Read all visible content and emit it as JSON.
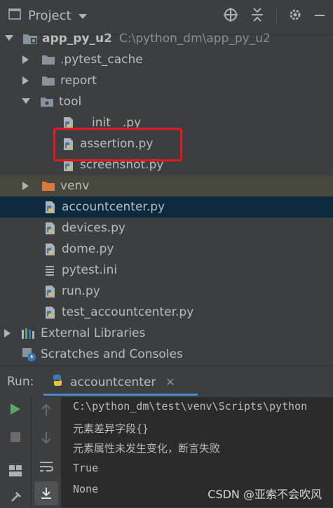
{
  "toolbar": {
    "title": "Project",
    "icons": [
      "target-icon",
      "collapse-icon",
      "gear-icon",
      "minimize-icon"
    ]
  },
  "tree": {
    "root": {
      "name": "app_py_u2",
      "path": "C:\\python_dm\\app_py_u2"
    },
    "items": [
      {
        "label": ".pytest_cache"
      },
      {
        "label": "report"
      },
      {
        "label": "tool"
      },
      {
        "label": "__init__.py"
      },
      {
        "label": "assertion.py"
      },
      {
        "label": "screenshot.py"
      },
      {
        "label": "venv"
      },
      {
        "label": "accountcenter.py"
      },
      {
        "label": "devices.py"
      },
      {
        "label": "dome.py"
      },
      {
        "label": "pytest.ini"
      },
      {
        "label": "run.py"
      },
      {
        "label": "test_accountcenter.py"
      },
      {
        "label": "External Libraries"
      },
      {
        "label": "Scratches and Consoles"
      }
    ]
  },
  "run": {
    "label": "Run:",
    "tab": "accountcenter"
  },
  "console": {
    "lines": [
      "C:\\python_dm\\test\\venv\\Scripts\\python",
      "元素差异字段{}",
      "元素属性未发生变化，断言失败",
      "True",
      "None"
    ]
  },
  "watermark": "CSDN @亚索不会吹风",
  "colors": {
    "background": "#3c3f41",
    "selected_row": "#0d293e",
    "highlight_box": "#e8161f",
    "run_green": "#59a869"
  }
}
